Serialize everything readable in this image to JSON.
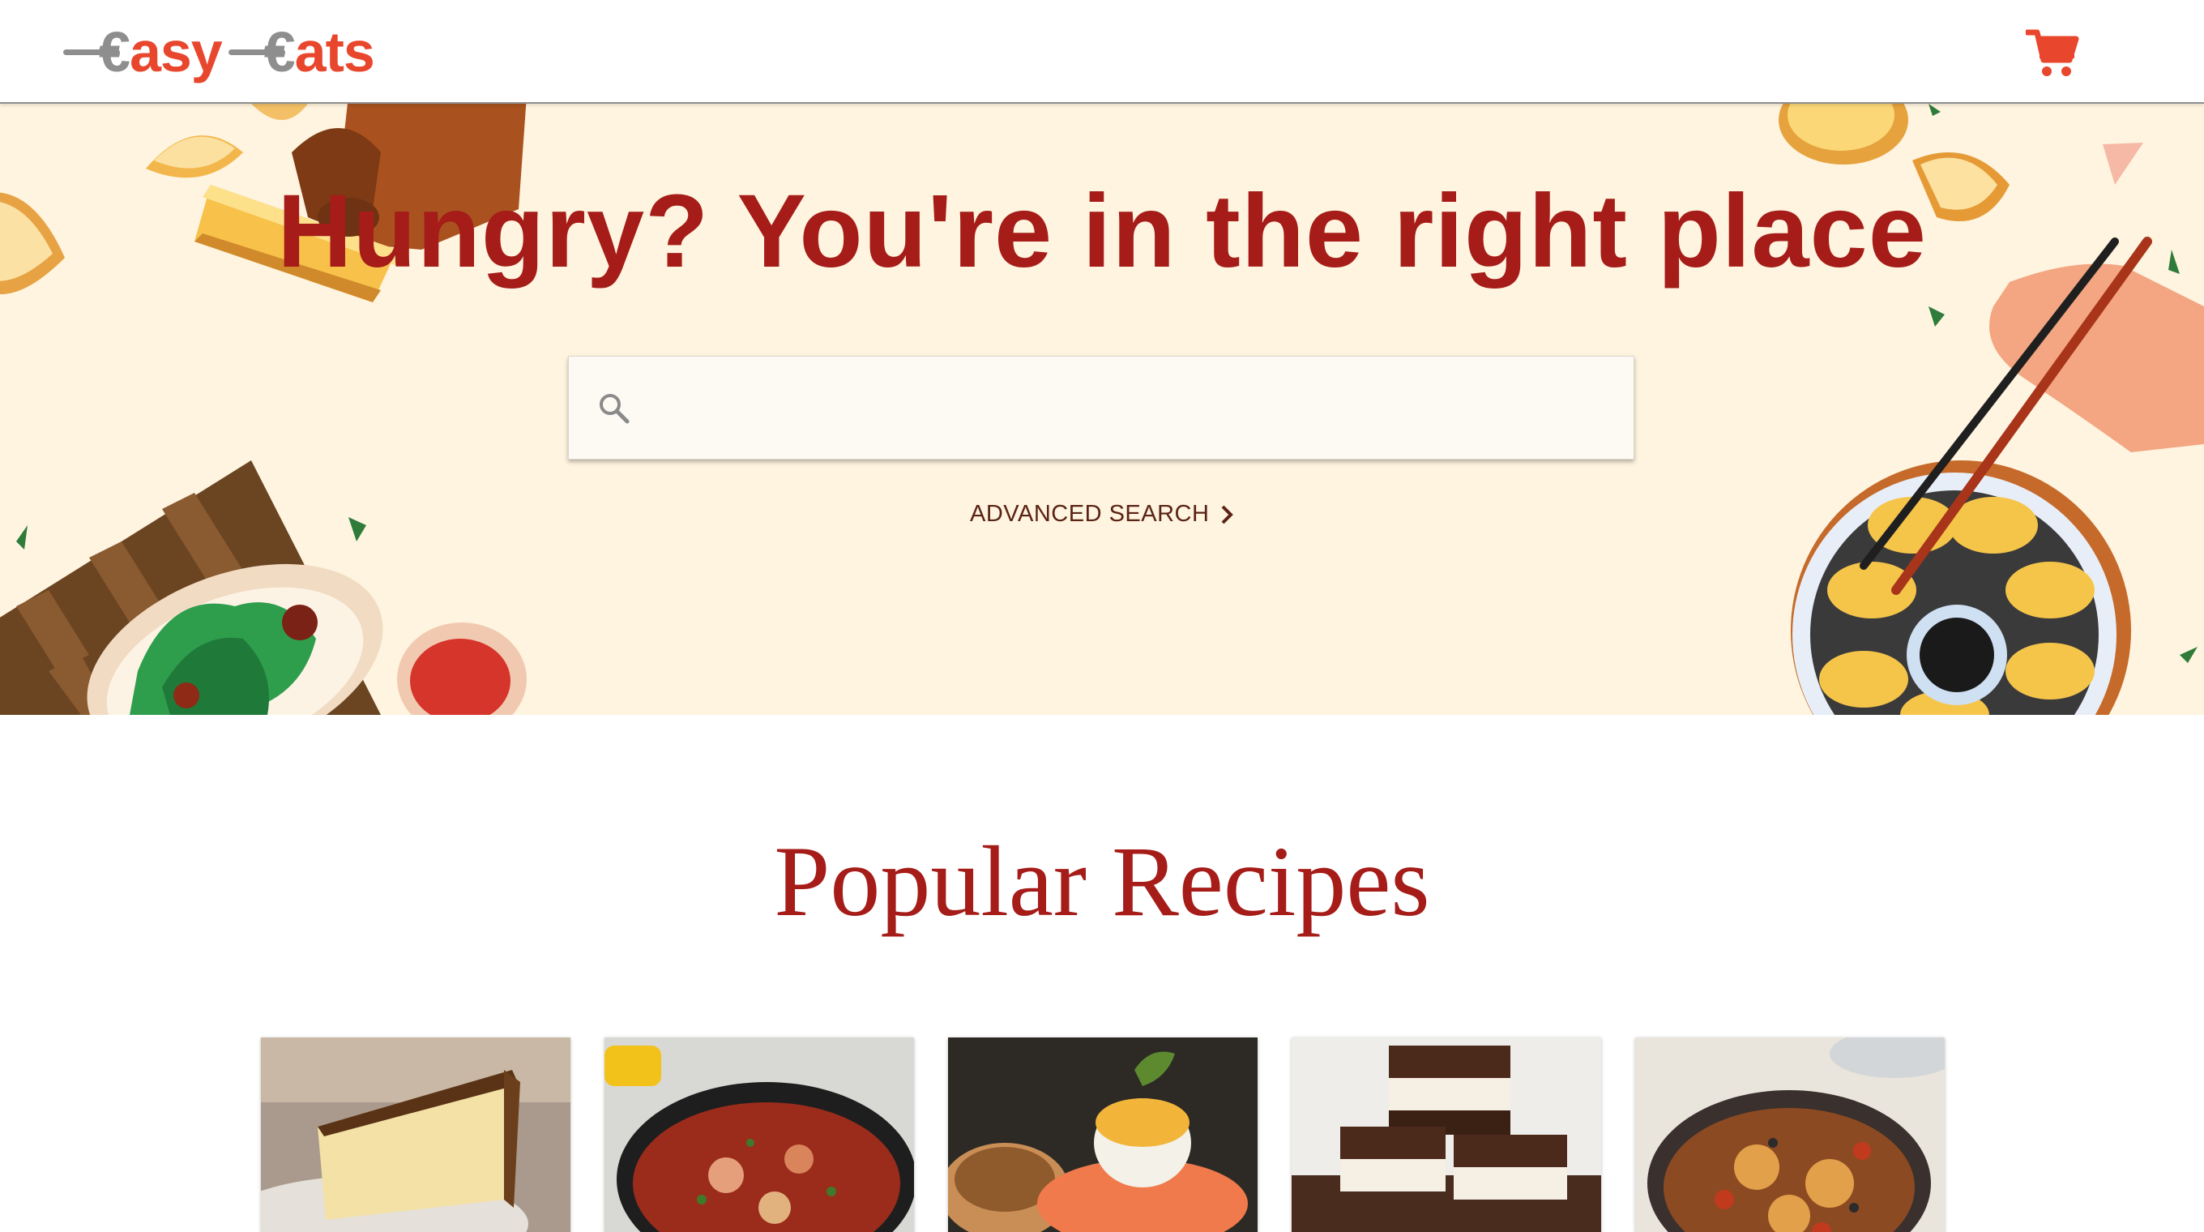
{
  "header": {
    "logo_left": {
      "glyph": "€",
      "rest": "asy"
    },
    "logo_right": {
      "glyph": "€",
      "rest": "ats"
    },
    "cart_icon": "shopping-cart-icon",
    "accent_color": "#e8472d",
    "logo_gray": "#8e8e8e"
  },
  "hero": {
    "title": "Hungry? You're in the right place",
    "title_color": "#a51c18",
    "background_color": "#fef4df",
    "search": {
      "placeholder": "",
      "value": "",
      "icon": "search-icon"
    },
    "advanced_search_label": "ADVANCED SEARCH",
    "advanced_search_icon": "chevron-right-icon"
  },
  "popular": {
    "title": "Popular Recipes",
    "recipes": [
      {
        "image": "cheesecake-slice"
      },
      {
        "image": "shakshuka-pot"
      },
      {
        "image": "eggs-benedict-salmon"
      },
      {
        "image": "chocolate-mint-bars"
      },
      {
        "image": "braised-chicken-pan"
      }
    ]
  }
}
